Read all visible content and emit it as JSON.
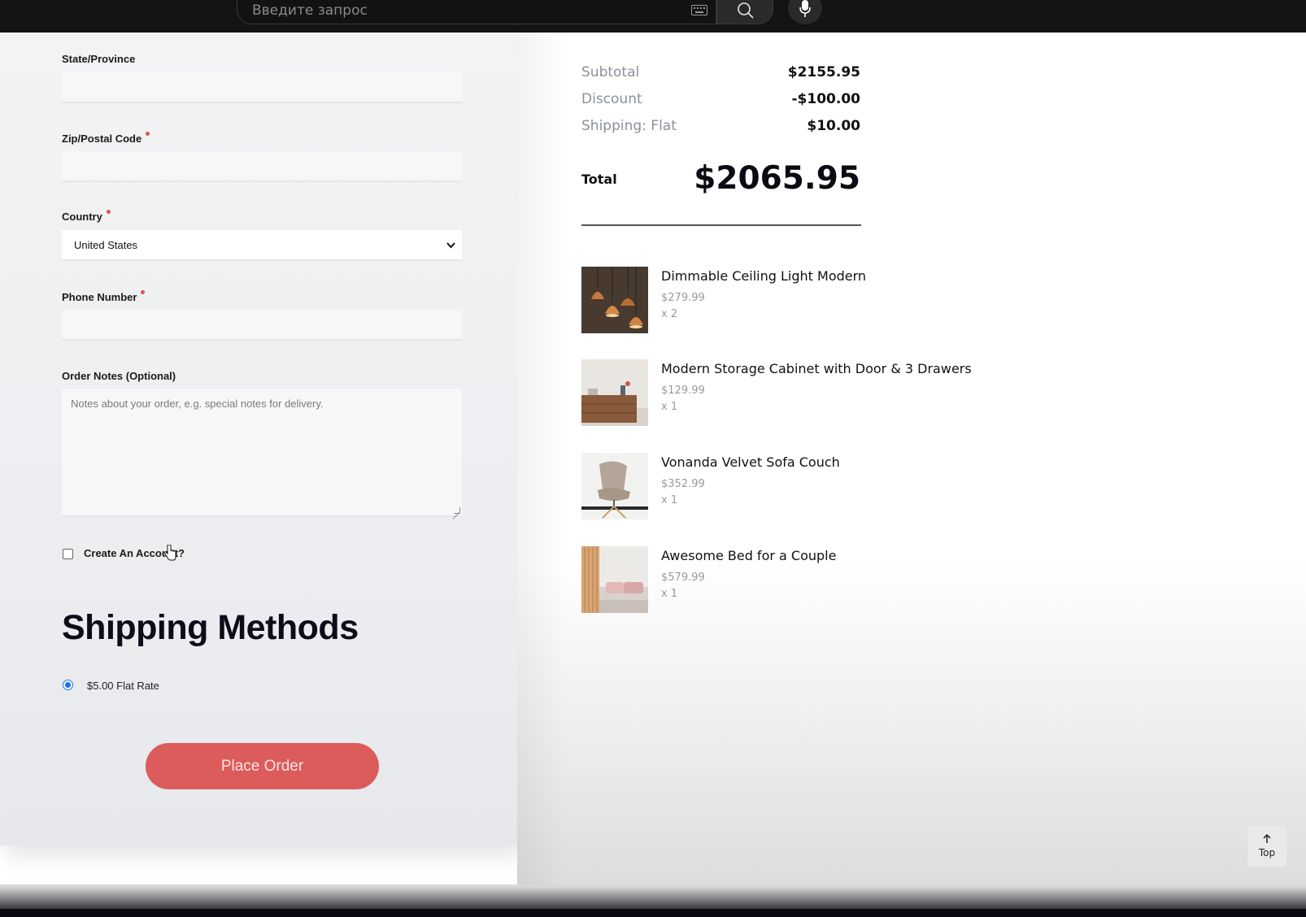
{
  "browser": {
    "search_placeholder": "Введите запрос",
    "keyboard_icon": "keyboard-icon",
    "search_icon": "search-icon",
    "mic_icon": "mic-icon"
  },
  "form": {
    "state_label": "State/Province",
    "state_value": "",
    "zip_label": "Zip/Postal Code",
    "zip_value": "",
    "country_label": "Country",
    "country_value": "United States",
    "phone_label": "Phone Number",
    "phone_value": "",
    "notes_label": "Order Notes (Optional)",
    "notes_placeholder": "Notes about your order, e.g. special notes for delivery.",
    "create_account_label": "Create An Account?",
    "create_account_checked": false,
    "required_color": "#e0544f"
  },
  "shipping": {
    "title": "Shipping Methods",
    "options": [
      {
        "label": "$5.00 Flat Rate",
        "selected": true
      }
    ]
  },
  "place_order_label": "Place Order",
  "summary": {
    "subtotal_label": "Subtotal",
    "subtotal_value": "$2155.95",
    "discount_label": "Discount",
    "discount_value": "-$100.00",
    "shipping_label": "Shipping: Flat",
    "shipping_value": "$10.00",
    "total_label": "Total",
    "total_value": "$2065.95"
  },
  "products": [
    {
      "name": "Dimmable Ceiling Light Modern",
      "price": "$279.99",
      "qty": "x 2"
    },
    {
      "name": "Modern Storage Cabinet with Door & 3 Drawers",
      "price": "$129.99",
      "qty": "x 1"
    },
    {
      "name": "Vonanda Velvet Sofa Couch",
      "price": "$352.99",
      "qty": "x 1"
    },
    {
      "name": "Awesome Bed for a Couple",
      "price": "$579.99",
      "qty": "x 1"
    }
  ],
  "top_button_label": "Top",
  "colors": {
    "accent_button": "#dc5b5b",
    "radio_selected": "#1a73e8"
  }
}
